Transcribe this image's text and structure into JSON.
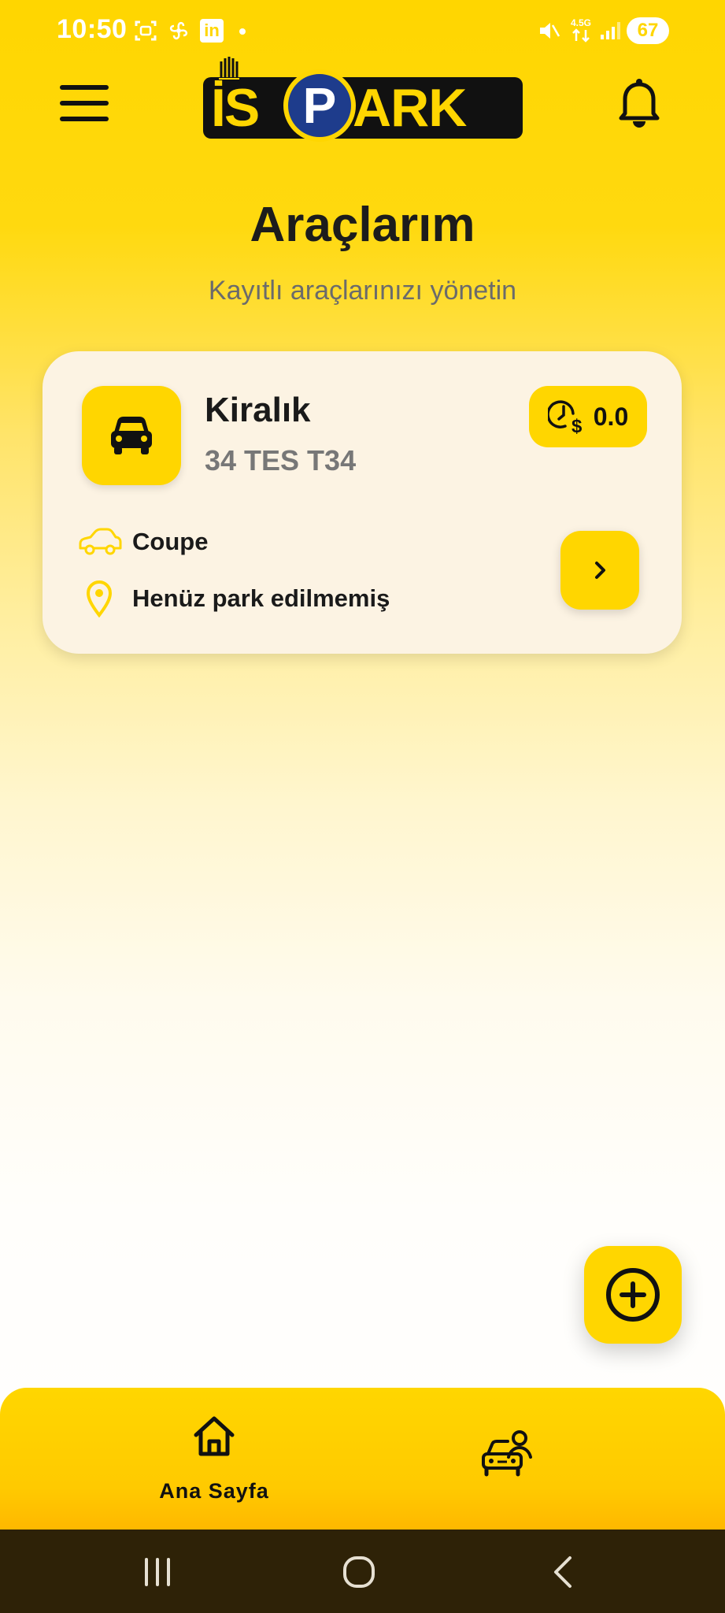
{
  "status_bar": {
    "time": "10:50",
    "network": "4.5G",
    "battery": "67",
    "icons": [
      "screenshot-icon",
      "fan-icon",
      "linkedin-icon",
      "dot-icon",
      "mute-icon",
      "network-icon",
      "signal-icon",
      "battery-icon"
    ]
  },
  "header": {
    "logo_left": "İS",
    "logo_mid": "P",
    "logo_right": "ARK",
    "menu_icon": "menu-icon",
    "bell_icon": "bell-icon"
  },
  "page": {
    "title": "Araçlarım",
    "subtitle": "Kayıtlı araçlarınızı yönetin"
  },
  "vehicle": {
    "name": "Kiralık",
    "plate": "34 TES T34",
    "balance": "0.0",
    "type": "Coupe",
    "location": "Henüz park edilmemiş"
  },
  "fab": {
    "icon": "add-circle-icon"
  },
  "bottom_nav": {
    "home_label": "Ana Sayfa",
    "home_icon": "home-icon",
    "cars_icon": "car-user-icon"
  },
  "system_nav": [
    "recents-icon",
    "home-circle-icon",
    "back-icon"
  ],
  "colors": {
    "accent": "#FFD600",
    "logo_blue": "#1E3C8C",
    "card_bg": "#FCF3E3",
    "system_nav_bg": "#2E2207"
  }
}
